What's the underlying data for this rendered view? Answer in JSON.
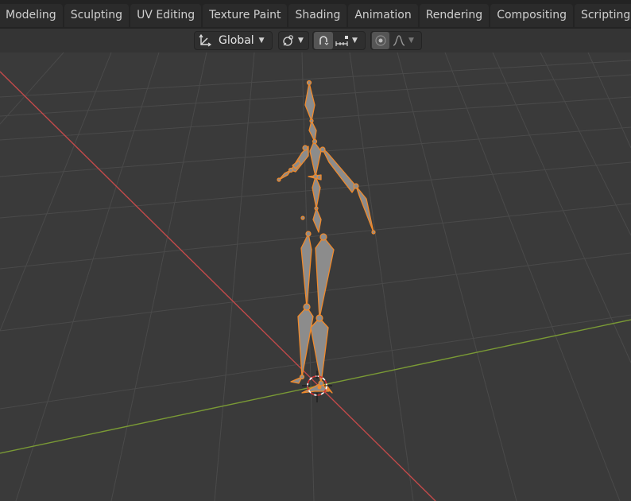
{
  "workspace_tabs": [
    {
      "label": "Modeling"
    },
    {
      "label": "Sculpting"
    },
    {
      "label": "UV Editing"
    },
    {
      "label": "Texture Paint"
    },
    {
      "label": "Shading"
    },
    {
      "label": "Animation"
    },
    {
      "label": "Rendering"
    },
    {
      "label": "Compositing"
    },
    {
      "label": "Scripting"
    }
  ],
  "header": {
    "transform_orientation": "Global",
    "icons": {
      "orientation": "transform-orientation-icon",
      "pivot": "pivot-point-icon",
      "snap": "snap-magnet-icon",
      "snap_target": "snap-increment-icon",
      "proportional": "proportional-editing-icon",
      "falloff": "falloff-curve-icon"
    }
  },
  "colors": {
    "tab_bar": "#232323",
    "tab": "#2b2b2b",
    "viewport": "#3a3a3a",
    "grid": "#4a4a4a",
    "x_axis": "#c24a4a",
    "y_axis": "#7a9a35",
    "bone_fill": "#8c8c8c",
    "bone_outline": "#f08a2c"
  },
  "viewport": {
    "object": "armature",
    "selected": true
  }
}
